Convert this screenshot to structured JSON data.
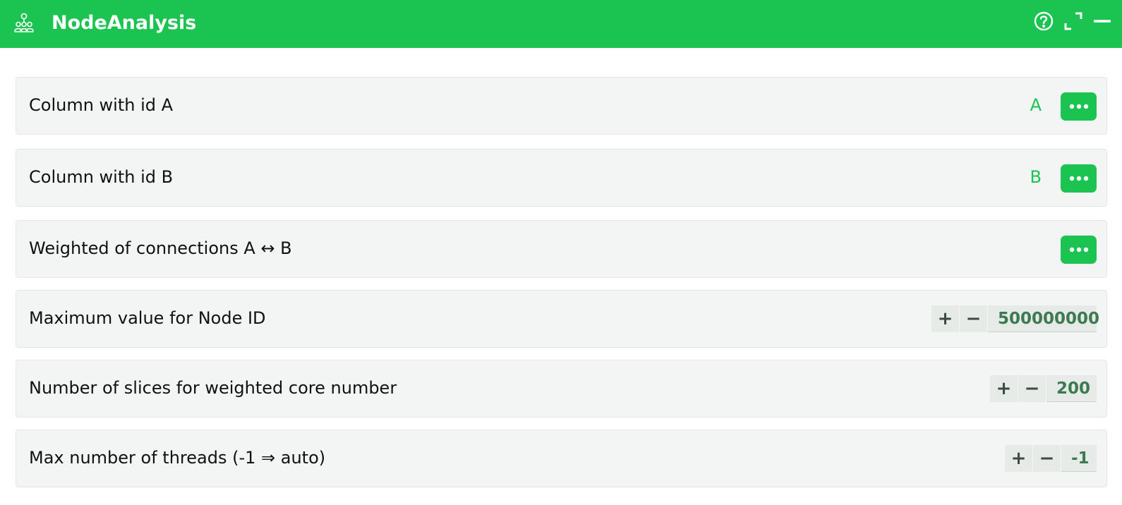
{
  "app": {
    "title": "NodeAnalysis",
    "icon": "people-hierarchy-icon",
    "accent_color": "#1bc451"
  },
  "titlebar_buttons": {
    "help": "help-icon",
    "expand": "expand-icon",
    "minimize": "minimize-icon"
  },
  "rows": {
    "col_a": {
      "label": "Column with id A",
      "value": "A"
    },
    "col_b": {
      "label": "Column with id B",
      "value": "B"
    },
    "weights": {
      "label": "Weighted of connections A ↔ B"
    },
    "max_node_id": {
      "label": "Maximum value for Node ID",
      "value": "500000000",
      "plus": "+",
      "minus": "−"
    },
    "slices": {
      "label": "Number of slices for weighted core number",
      "value": "200",
      "plus": "+",
      "minus": "−"
    },
    "threads": {
      "label": "Max number of threads (-1 ⇒ auto)",
      "value": "-1",
      "plus": "+",
      "minus": "−"
    }
  }
}
